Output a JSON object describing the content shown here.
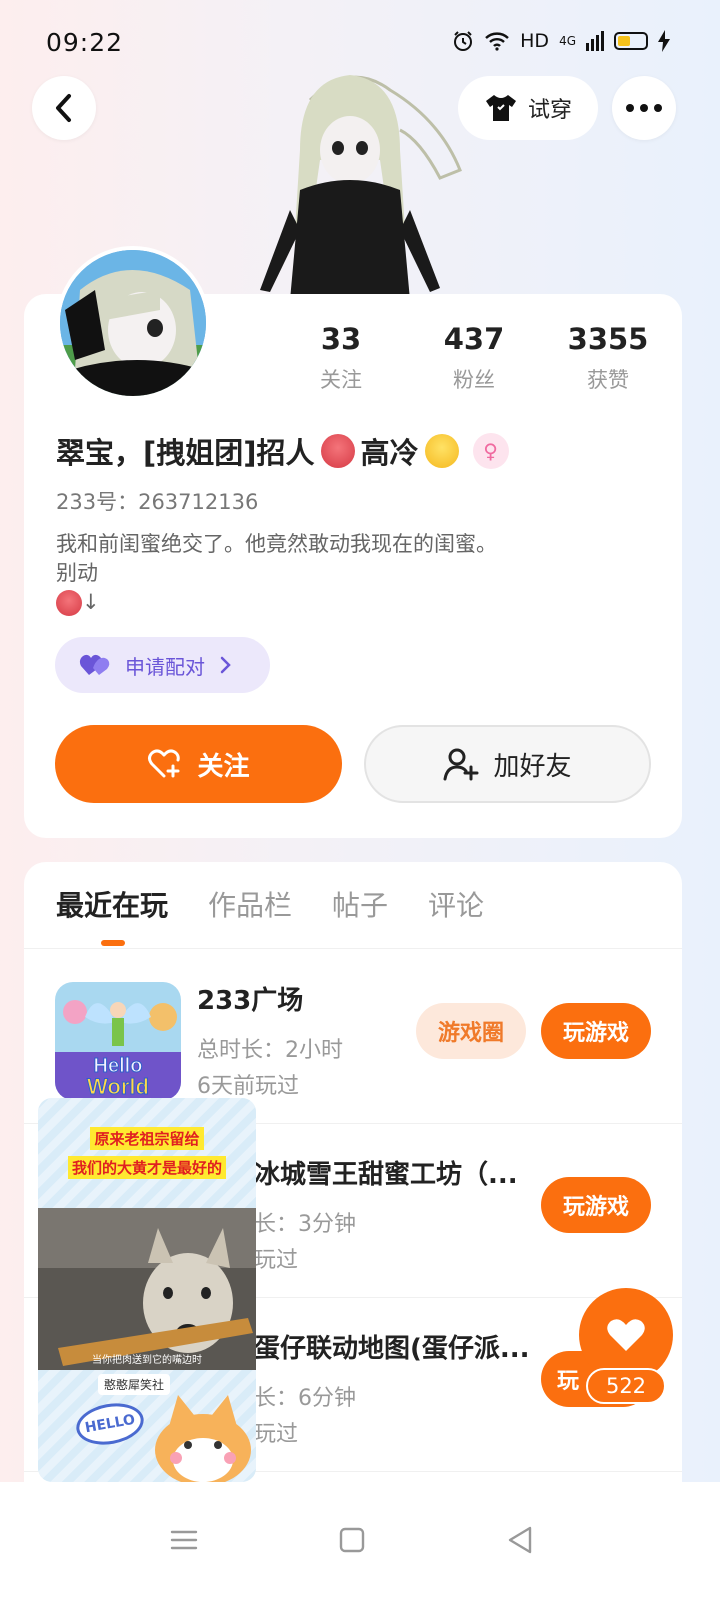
{
  "status_bar": {
    "time": "09:22",
    "network": "HD",
    "signal": "4G"
  },
  "header": {
    "back_icon": "chevron-left-icon",
    "tryon_label": "试穿",
    "tryon_icon": "tshirt-icon",
    "more_icon": "more-dots-icon"
  },
  "profile": {
    "stats": [
      {
        "value": "33",
        "label": "关注"
      },
      {
        "value": "437",
        "label": "粉丝"
      },
      {
        "value": "3355",
        "label": "获赞"
      }
    ],
    "nickname_part1": "翠宝，[拽姐团]招人",
    "nickname_part2": "高冷",
    "gender_icon": "female-icon",
    "uid": "233号：263712136",
    "bio": "我和前闺蜜绝交了。他竟然敢动我现在的闺蜜。\n别动",
    "bio_suffix": "↓",
    "pair_label": "申请配对",
    "follow_label": "关注",
    "add_friend_label": "加好友"
  },
  "tabs": [
    "最近在玩",
    "作品栏",
    "帖子",
    "评论"
  ],
  "games": [
    {
      "title": "233广场",
      "duration": "总时长：2小时",
      "last_played": "6天前玩过",
      "circle_label": "游戏圈",
      "play_label": "玩游戏"
    },
    {
      "title": "冰城雪王甜蜜工坊（...",
      "duration": "长：3分钟",
      "last_played": "玩过",
      "play_label": "玩游戏"
    },
    {
      "title": "蛋仔联动地图(蛋仔派...",
      "duration": "长：6分钟",
      "last_played": "玩过",
      "play_label": "玩"
    }
  ],
  "float_video": {
    "caption_line1": "原来老祖宗留给",
    "caption_line2": "我们的大黄才是最好的",
    "subtitle": "当你把肉送到它的嘴边时",
    "tag": "憨憨犀笑社",
    "hello": "HELLO"
  },
  "like": {
    "count": "522"
  },
  "colors": {
    "accent": "#fb6f0f",
    "pair_purple": "#6a55d8"
  }
}
